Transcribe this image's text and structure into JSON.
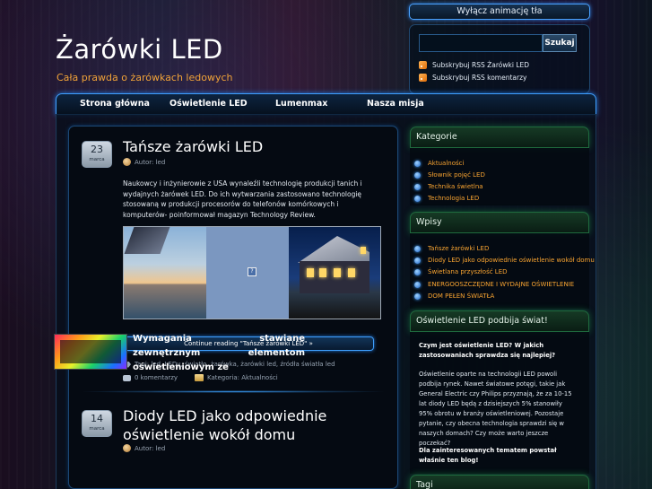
{
  "header": {
    "title": "Żarówki LED",
    "tagline": "Cała prawda o żarówkach ledowych"
  },
  "top": {
    "animation_button": "Wyłącz animację tła",
    "search_placeholder": "",
    "search_button": "Szukaj",
    "rss_posts": "Subskrybuj RSS Żarówki LED",
    "rss_comments": "Subskrybuj RSS komentarzy"
  },
  "nav": {
    "items": [
      "Strona główna",
      "Oświetlenie LED",
      "Lumenmax",
      "Nasza misja"
    ]
  },
  "posts": [
    {
      "day": "23",
      "month": "marca",
      "title": "Tańsze żarówki LED",
      "author": "Autor: led",
      "excerpt": "Naukowcy i inżynierowie z USA wynaleźli technologię produkcji tanich i wydajnych żarówek LED. Do ich wytwarzania zastosowano technologię stosowaną w produkcji procesorów do telefonów komórkowych i komputerów- poinformował magazyn Technology Review.",
      "continue": "Continue reading \"Tańsze żarówki LED\" »",
      "tags": "Tagi: led, LEDy, światło, żarówka, żarówki led, źródła światła led",
      "comments": "0 komentarzy",
      "category": "Kategoria: Aktualności"
    },
    {
      "day": "14",
      "month": "marca",
      "title": "Diody LED jako odpowiednie oświetlenie wokół domu",
      "author": "Autor: led",
      "excerpt": "Wymagania stawiane zewnętrznym elementom oświetleniowym ze"
    }
  ],
  "sidebar": {
    "categories": {
      "title": "Kategorie",
      "items": [
        "Aktualności",
        "Słownik pojęć LED",
        "Technika świetlna",
        "Technologia LED"
      ]
    },
    "posts": {
      "title": "Wpisy",
      "items": [
        "Tańsze żarówki LED",
        "Diody LED jako odpowiednie oświetlenie wokół domu",
        "Świetlana przyszłość LED",
        "ENERGOOSZCZĘDNE I WYDAJNE OŚWIETLENIE",
        "DOM PEŁEN ŚWIATŁA"
      ]
    },
    "promo": {
      "title": "Oświetlenie LED podbija świat!",
      "question": "Czym jest oświetlenie LED? W jakich zastosowaniach sprawdza się najlepiej?",
      "body": "Oświetlenie oparte na technologii LED powoli podbija rynek. Nawet światowe potęgi, takie jak General Electric czy Philips przyznają, że za 10-15 lat diody LED będą z dzisiejszych 5% stanowiły 95% obrotu w branży oświetleniowej. Pozostaje pytanie, czy obecna technologia sprawdzi się w naszych domach? Czy może warto jeszcze poczekać?",
      "footer": "Dla zainteresowanych tematem powstał właśnie ten blog!"
    },
    "tags_title": "Tagi"
  },
  "colors": {
    "accent_blue": "#3fa0ff",
    "link_orange": "#f7a331",
    "widget_green": "#1f6a3e"
  }
}
